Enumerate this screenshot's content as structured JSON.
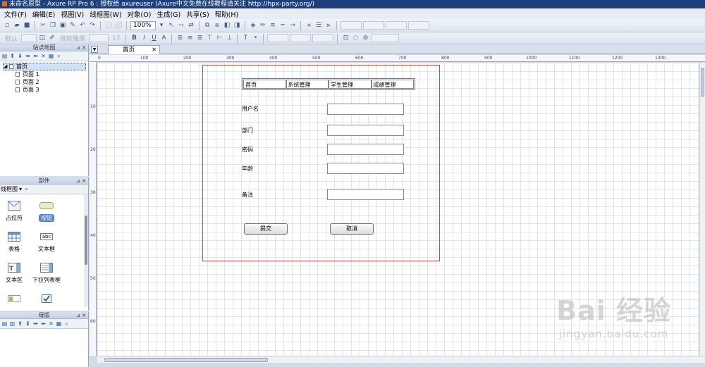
{
  "window": {
    "title": "未命名原型 - Axure RP Pro 6 : 授权给 axureuser (Axure中文免费在线教程请关注 http://hpx-party.org/)"
  },
  "menu": [
    "文件(F)",
    "编辑(E)",
    "视图(V)",
    "线框图(W)",
    "对象(O)",
    "生成(G)",
    "共享(S)",
    "帮助(H)"
  ],
  "toolbar": {
    "zoom": "100%",
    "style_default": "默认",
    "font": "微软雅黑",
    "font_size": "13"
  },
  "sitemap": {
    "title": "站点地图",
    "root": "首页",
    "pages": [
      "页面 1",
      "页面 2",
      "页面 3"
    ]
  },
  "widgets": {
    "title": "部件",
    "library": "线框图",
    "items": [
      "占位符",
      "按钮",
      "表格",
      "文本框",
      "文本区",
      "下拉列表框"
    ],
    "button_text": "按钮",
    "textbox_text": "abc"
  },
  "masters": {
    "title": "母版"
  },
  "document": {
    "tab": "首页"
  },
  "ruler": {
    "top": [
      "0",
      "100",
      "200",
      "300",
      "400",
      "500",
      "600",
      "700",
      "800",
      "900",
      "1000",
      "1100",
      "1200",
      "1300"
    ],
    "left": [
      "100",
      "200",
      "300",
      "400",
      "500",
      "600"
    ]
  },
  "design": {
    "nav": [
      "首页",
      "系统管理",
      "学生管理",
      "成绩管理"
    ],
    "fields": [
      {
        "label": "用户名",
        "value": ""
      },
      {
        "label": "部门",
        "value": ""
      },
      {
        "label": "密码",
        "value": ""
      },
      {
        "label": "年龄",
        "value": ""
      },
      {
        "label": "备注",
        "value": ""
      }
    ],
    "submit": "提交",
    "cancel": "取消"
  },
  "watermark": {
    "logo": "Bai 经验",
    "url": "jingyan.baidu.com"
  }
}
